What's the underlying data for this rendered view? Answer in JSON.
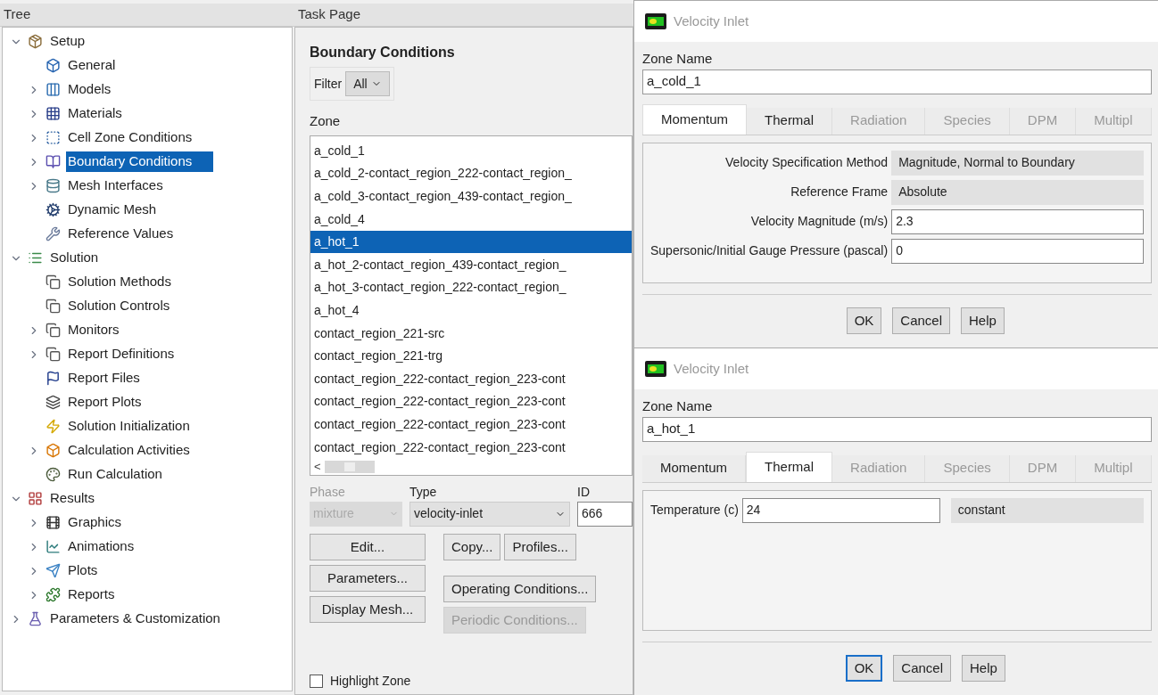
{
  "tree": {
    "header": "Tree",
    "items": [
      {
        "label": "Setup",
        "expanded": true,
        "selected": false,
        "children": [
          {
            "label": "General",
            "selected": false
          },
          {
            "label": "Models",
            "expanded": false,
            "selected": false
          },
          {
            "label": "Materials",
            "expanded": false,
            "selected": false
          },
          {
            "label": "Cell Zone Conditions",
            "expanded": false,
            "selected": false
          },
          {
            "label": "Boundary Conditions",
            "expanded": false,
            "selected": true
          },
          {
            "label": "Mesh Interfaces",
            "expanded": false,
            "selected": false
          },
          {
            "label": "Dynamic Mesh",
            "selected": false
          },
          {
            "label": "Reference Values",
            "selected": false
          }
        ]
      },
      {
        "label": "Solution",
        "expanded": true,
        "selected": false,
        "children": [
          {
            "label": "Solution Methods",
            "selected": false
          },
          {
            "label": "Solution Controls",
            "selected": false
          },
          {
            "label": "Monitors",
            "expanded": false,
            "selected": false
          },
          {
            "label": "Report Definitions",
            "expanded": false,
            "selected": false
          },
          {
            "label": "Report Files",
            "selected": false
          },
          {
            "label": "Report Plots",
            "selected": false
          },
          {
            "label": "Solution Initialization",
            "selected": false
          },
          {
            "label": "Calculation Activities",
            "expanded": false,
            "selected": false
          },
          {
            "label": "Run Calculation",
            "selected": false
          }
        ]
      },
      {
        "label": "Results",
        "expanded": true,
        "selected": false,
        "children": [
          {
            "label": "Graphics",
            "expanded": false,
            "selected": false
          },
          {
            "label": "Animations",
            "expanded": false,
            "selected": false
          },
          {
            "label": "Plots",
            "expanded": false,
            "selected": false
          },
          {
            "label": "Reports",
            "expanded": false,
            "selected": false
          }
        ]
      },
      {
        "label": "Parameters & Customization",
        "expanded": false,
        "selected": false
      }
    ]
  },
  "task_page": {
    "header": "Task Page",
    "title": "Boundary Conditions",
    "filter": {
      "label": "Filter",
      "value": "All"
    },
    "zone_label": "Zone",
    "zones": [
      {
        "label": "a_cold_1",
        "selected": false
      },
      {
        "label": "a_cold_2-contact_region_222-contact_region_",
        "selected": false
      },
      {
        "label": "a_cold_3-contact_region_439-contact_region_",
        "selected": false
      },
      {
        "label": "a_cold_4",
        "selected": false
      },
      {
        "label": "a_hot_1",
        "selected": true
      },
      {
        "label": "a_hot_2-contact_region_439-contact_region_",
        "selected": false
      },
      {
        "label": "a_hot_3-contact_region_222-contact_region_",
        "selected": false
      },
      {
        "label": "a_hot_4",
        "selected": false
      },
      {
        "label": "contact_region_221-src",
        "selected": false
      },
      {
        "label": "contact_region_221-trg",
        "selected": false
      },
      {
        "label": "contact_region_222-contact_region_223-cont",
        "selected": false
      },
      {
        "label": "contact_region_222-contact_region_223-cont",
        "selected": false
      },
      {
        "label": "contact_region_222-contact_region_223-cont",
        "selected": false
      },
      {
        "label": "contact_region_222-contact_region_223-cont",
        "selected": false
      }
    ],
    "scroll_left": "<",
    "phase": {
      "label": "Phase",
      "value": "mixture",
      "disabled": true
    },
    "type": {
      "label": "Type",
      "value": "velocity-inlet",
      "disabled": false
    },
    "id": {
      "label": "ID",
      "value": "666"
    },
    "buttons": [
      {
        "label": "Edit...",
        "disabled": false
      },
      {
        "label": "Copy...",
        "disabled": false
      },
      {
        "label": "Profiles...",
        "disabled": false
      },
      {
        "label": "Parameters...",
        "disabled": false
      },
      {
        "label": "Operating Conditions...",
        "disabled": false
      },
      {
        "label": "Display Mesh...",
        "disabled": false
      },
      {
        "label": "Periodic Conditions...",
        "disabled": true
      }
    ],
    "highlight": {
      "label": "Highlight Zone",
      "checked": false
    }
  },
  "dialogs": [
    {
      "title": "Velocity Inlet",
      "kind": "form",
      "zone_label": "Zone Name",
      "zone_value": "a_cold_1",
      "tabs": [
        {
          "label": "Momentum",
          "selected": true,
          "disabled": false
        },
        {
          "label": "Thermal",
          "selected": false,
          "disabled": false
        },
        {
          "label": "Radiation",
          "selected": false,
          "disabled": true
        },
        {
          "label": "Species",
          "selected": false,
          "disabled": true
        },
        {
          "label": "DPM",
          "selected": false,
          "disabled": true
        },
        {
          "label": "Multipl",
          "selected": false,
          "disabled": true
        }
      ],
      "fields": [
        {
          "label": "Velocity Specification Method",
          "kind": "dropdown",
          "value": "Magnitude, Normal to Boundary"
        },
        {
          "label": "Reference Frame",
          "kind": "dropdown",
          "value": "Absolute"
        },
        {
          "label": "Velocity Magnitude (m/s)",
          "kind": "input",
          "value": "2.3"
        },
        {
          "label": "Supersonic/Initial Gauge Pressure (pascal)",
          "kind": "input",
          "value": "0"
        }
      ],
      "buttons": [
        {
          "label": "OK",
          "focused": false
        },
        {
          "label": "Cancel",
          "focused": false
        },
        {
          "label": "Help",
          "focused": false
        }
      ]
    },
    {
      "title": "Velocity Inlet",
      "kind": "inline",
      "zone_label": "Zone Name",
      "zone_value": "a_hot_1",
      "tabs": [
        {
          "label": "Momentum",
          "selected": false,
          "disabled": false
        },
        {
          "label": "Thermal",
          "selected": true,
          "disabled": false
        },
        {
          "label": "Radiation",
          "selected": false,
          "disabled": true
        },
        {
          "label": "Species",
          "selected": false,
          "disabled": true
        },
        {
          "label": "DPM",
          "selected": false,
          "disabled": true
        },
        {
          "label": "Multipl",
          "selected": false,
          "disabled": true
        }
      ],
      "fields": [
        {
          "label": "Temperature (c)",
          "kind": "input",
          "value": "24"
        },
        {
          "kind": "dropdown",
          "value": "constant"
        }
      ],
      "buttons": [
        {
          "label": "OK",
          "focused": true
        },
        {
          "label": "Cancel",
          "focused": false
        },
        {
          "label": "Help",
          "focused": false
        }
      ]
    }
  ]
}
